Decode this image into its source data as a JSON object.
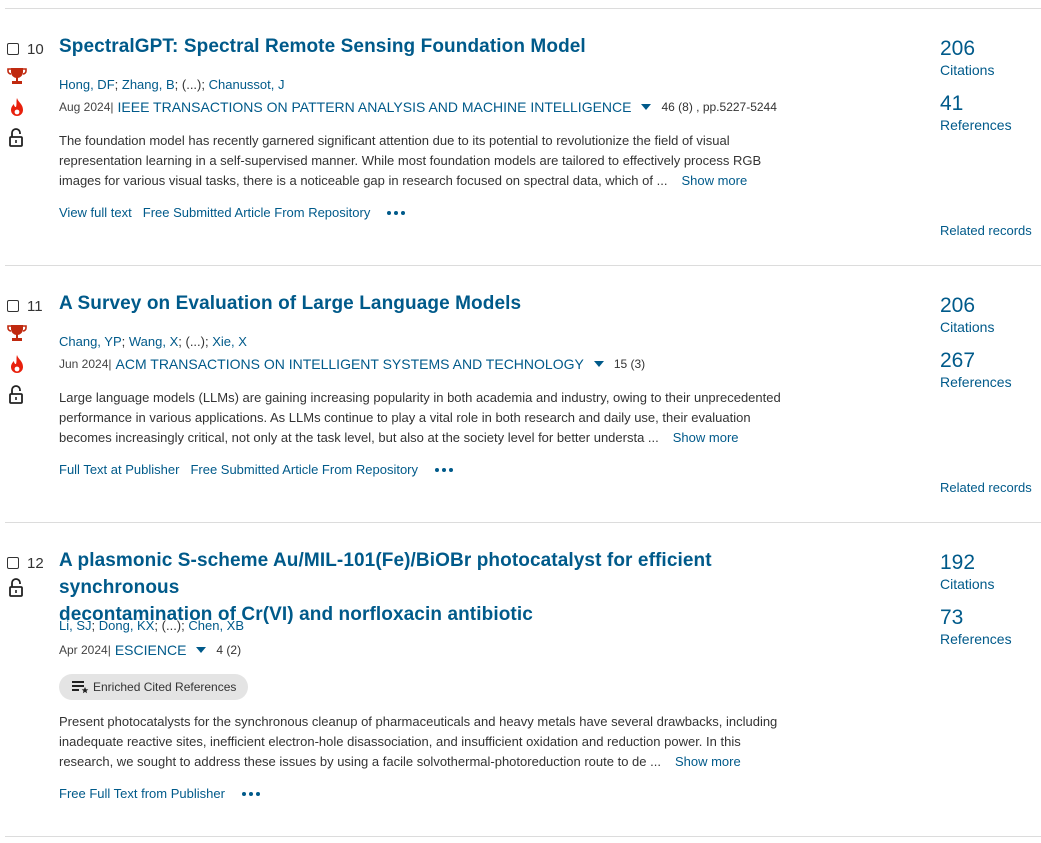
{
  "records": [
    {
      "number": "10",
      "title_lines": [
        "SpectralGPT: Spectral Remote Sensing Foundation Model"
      ],
      "authors": [
        "Hong, DF",
        "Zhang, B",
        "(...)",
        "Chanussot, J"
      ],
      "date": "Aug 2024",
      "date_sep": " |",
      "journal": "IEEE TRANSACTIONS ON PATTERN ANALYSIS AND MACHINE INTELLIGENCE",
      "volume": "46 (8) , pp.5227-5244",
      "abstract_lines": [
        "The foundation model has recently garnered significant attention due to its potential to revolutionize the field of visual",
        "representation learning in a self-supervised manner. While most foundation models are tailored to effectively process RGB",
        "images for various visual tasks, there is a noticeable gap in research focused on spectral data, which of ..."
      ],
      "show_more": "Show more",
      "links": [
        "View full text",
        "Free Submitted Article From Repository"
      ],
      "citations": "206",
      "citations_label": "Citations",
      "references": "41",
      "references_label": "References",
      "related": "Related records",
      "icons": [
        "trophy-icon",
        "fire-icon",
        "open-lock-icon"
      ]
    },
    {
      "number": "11",
      "title_lines": [
        "A Survey on Evaluation of Large Language Models"
      ],
      "authors": [
        "Chang, YP",
        "Wang, X",
        "(...)",
        "Xie, X"
      ],
      "date": "Jun 2024",
      "date_sep": " |",
      "journal": "ACM TRANSACTIONS ON INTELLIGENT SYSTEMS AND TECHNOLOGY",
      "volume": "15 (3)",
      "abstract_lines": [
        "Large language models (LLMs) are gaining increasing popularity in both academia and industry, owing to their unprecedented",
        "performance in various applications. As LLMs continue to play a vital role in both research and daily use, their evaluation",
        "becomes increasingly critical, not only at the task level, but also at the society level for better understa ..."
      ],
      "show_more": "Show more",
      "links": [
        "Full Text at Publisher",
        "Free Submitted Article From Repository"
      ],
      "citations": "206",
      "citations_label": "Citations",
      "references": "267",
      "references_label": "References",
      "related": "Related records",
      "icons": [
        "trophy-icon",
        "fire-icon",
        "open-lock-icon"
      ]
    },
    {
      "number": "12",
      "title_lines": [
        "A plasmonic S-scheme Au/MIL-101(Fe)/BiOBr photocatalyst for efficient synchronous",
        "decontamination of Cr(VI) and norfloxacin antibiotic"
      ],
      "authors": [
        "Li, SJ",
        "Dong, KX",
        "(...)",
        "Chen, XB"
      ],
      "date": "Apr 2024",
      "date_sep": " |",
      "journal": "ESCIENCE",
      "volume": "4 (2)",
      "badge": "Enriched Cited References",
      "abstract_lines": [
        "Present photocatalysts for the synchronous cleanup of pharmaceuticals and heavy metals have several drawbacks, including",
        "inadequate reactive sites, inefficient electron-hole disassociation, and insufficient oxidation and reduction power. In this",
        "research, we sought to address these issues by using a facile solvothermal-photoreduction route to de ..."
      ],
      "show_more": "Show more",
      "links": [
        "Free Full Text from Publisher"
      ],
      "citations": "192",
      "citations_label": "Citations",
      "references": "73",
      "references_label": "References",
      "icons": [
        "open-lock-icon"
      ]
    }
  ],
  "colors": {
    "link": "#005a8a",
    "trophy": "#c0290f",
    "fire": "#e8200c",
    "divider": "#dcdcdc"
  }
}
